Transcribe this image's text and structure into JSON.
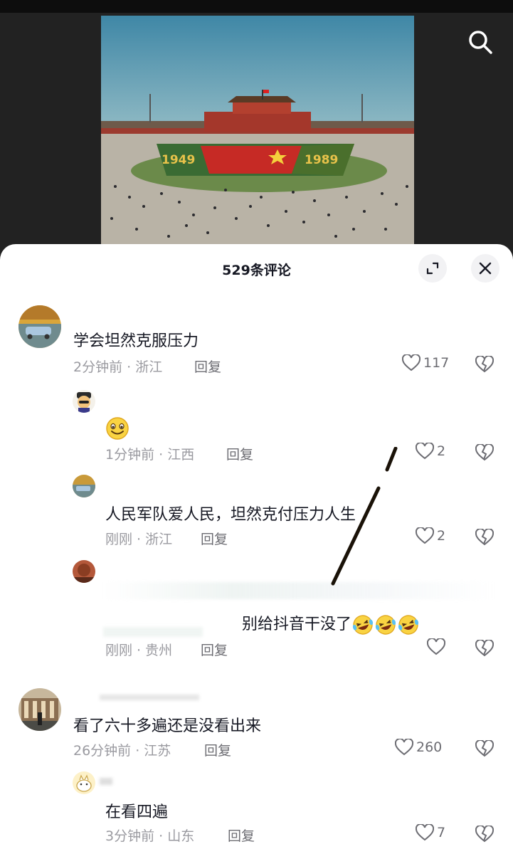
{
  "video": {
    "banner_left_year": "1949",
    "banner_right_year": "1989",
    "search_icon": "search-icon"
  },
  "sheet": {
    "count_label": "529条评论",
    "expand_icon": "expand-icon",
    "close_icon": "close-icon"
  },
  "comments": [
    {
      "text": "学会坦然克服压力",
      "meta": "2分钟前 · 浙江",
      "reply": "回复",
      "likes": "117"
    },
    {
      "text": "",
      "emoji": "smiling-face",
      "meta": "1分钟前 · 江西",
      "reply": "回复",
      "likes": "2"
    },
    {
      "text": "人民军队爱人民，坦然克付压力人生",
      "meta": "刚刚 · 浙江",
      "reply": "回复",
      "likes": "2"
    },
    {
      "text": "别给抖音干没了",
      "emoji": "rolling-laughing-face",
      "meta": "刚刚 · 贵州",
      "reply": "回复",
      "likes": ""
    },
    {
      "text": "看了六十多遍还是没看出来",
      "meta": "26分钟前 · 江苏",
      "reply": "回复",
      "likes": "260"
    },
    {
      "text": "在看四遍",
      "meta": "3分钟前 · 山东",
      "reply": "回复",
      "likes": "7"
    }
  ],
  "colors": {
    "text": "#161823",
    "meta": "#9a9aa0",
    "sheet_bg": "#ffffff",
    "backdrop": "#1e1e1e"
  }
}
